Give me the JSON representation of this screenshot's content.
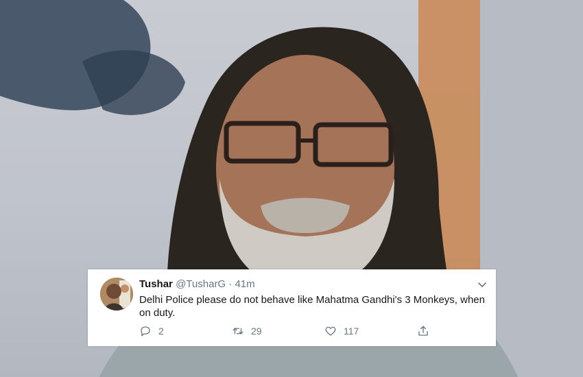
{
  "tweet": {
    "name": "Tushar",
    "handle": "@TusharG",
    "separator": "·",
    "time": "41m",
    "text": "Delhi Police please do not behave like Mahatma Gandhi's 3 Monkeys, when on duty.",
    "replies": "2",
    "retweets": "29",
    "likes": "117"
  },
  "icons": {
    "reply": "reply-icon",
    "retweet": "retweet-icon",
    "like": "like-icon",
    "share": "share-icon",
    "menu": "chevron-down-icon"
  },
  "colors": {
    "text_primary": "#14171a",
    "text_secondary": "#657786",
    "card_background": "#ffffff"
  }
}
